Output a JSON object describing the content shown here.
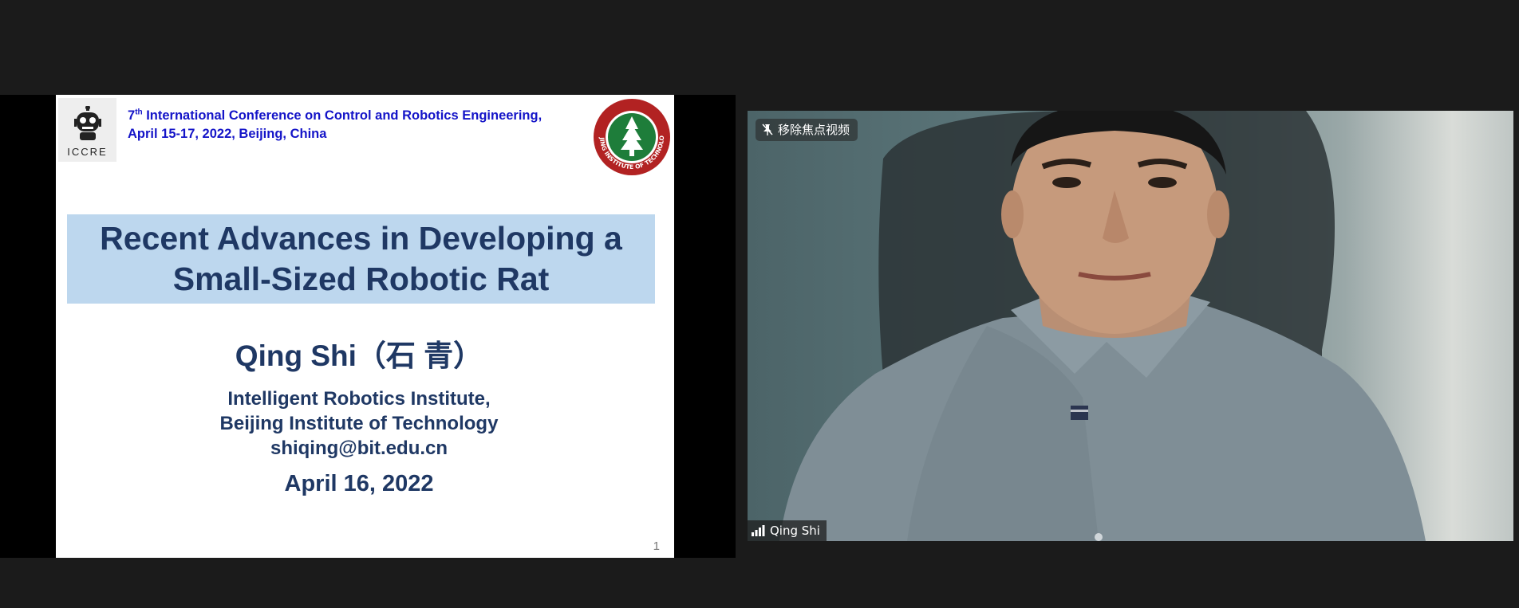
{
  "slide": {
    "logo_text": "ICCRE",
    "conf_ordinal_number": "7",
    "conf_ordinal_suffix": "th",
    "conf_line1_rest": " International Conference on Control and Robotics Engineering,",
    "conf_line2": "April 15-17, 2022, Beijing, China",
    "seal_text": "BEIJING INSTITUTE OF TECHNOLOGY",
    "title_line1": "Recent Advances in Developing a",
    "title_line2": "Small-Sized Robotic Rat",
    "author": "Qing Shi（石 青）",
    "affiliation_line1": "Intelligent Robotics Institute,",
    "affiliation_line2": "Beijing Institute of Technology",
    "email": "shiqing@bit.edu.cn",
    "date": "April 16, 2022",
    "page_number": "1",
    "colors": {
      "title_bg": "#bdd7ee",
      "title_text": "#1f3864",
      "conference_text": "#1414c8",
      "seal_red": "#b22222",
      "seal_green": "#1e7d3a"
    }
  },
  "video": {
    "unpin_label": "移除焦点视频",
    "unpin_icon": "pin-icon",
    "participant_name": "Qing Shi",
    "signal_icon": "signal-strength-icon"
  }
}
